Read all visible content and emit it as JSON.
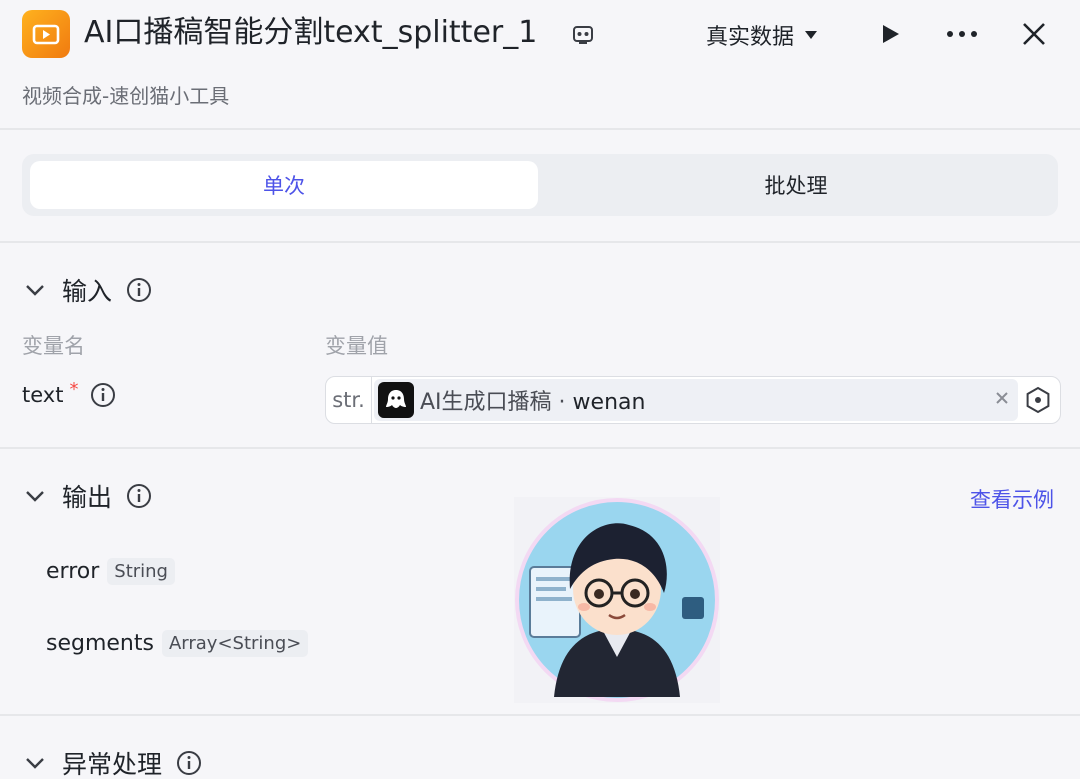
{
  "header": {
    "title": "AI口播稿智能分割text_splitter_1",
    "subtitle": "视频合成-速创猫小工具",
    "data_mode": "真实数据",
    "icons": [
      "video-app-icon",
      "copy-id-icon",
      "caret-down-icon",
      "play-icon",
      "more-icon",
      "close-icon"
    ]
  },
  "tabs": [
    {
      "label": "单次",
      "active": true
    },
    {
      "label": "批处理",
      "active": false
    }
  ],
  "input": {
    "section_title": "输入",
    "col_name": "变量名",
    "col_value": "变量值",
    "var_name": "text",
    "required_mark": "*",
    "type_prefix": "str.",
    "ref_source": "AI生成口播稿",
    "ref_sep": "·",
    "ref_var": "wenan"
  },
  "output": {
    "section_title": "输出",
    "example_link": "查看示例",
    "fields": [
      {
        "name": "error",
        "type": "String"
      },
      {
        "name": "segments",
        "type": "Array<String>"
      }
    ]
  },
  "exception": {
    "section_title": "异常处理"
  },
  "colors": {
    "accent": "#4d53e8",
    "required": "#f54a45",
    "app_icon": "#f59a16"
  }
}
